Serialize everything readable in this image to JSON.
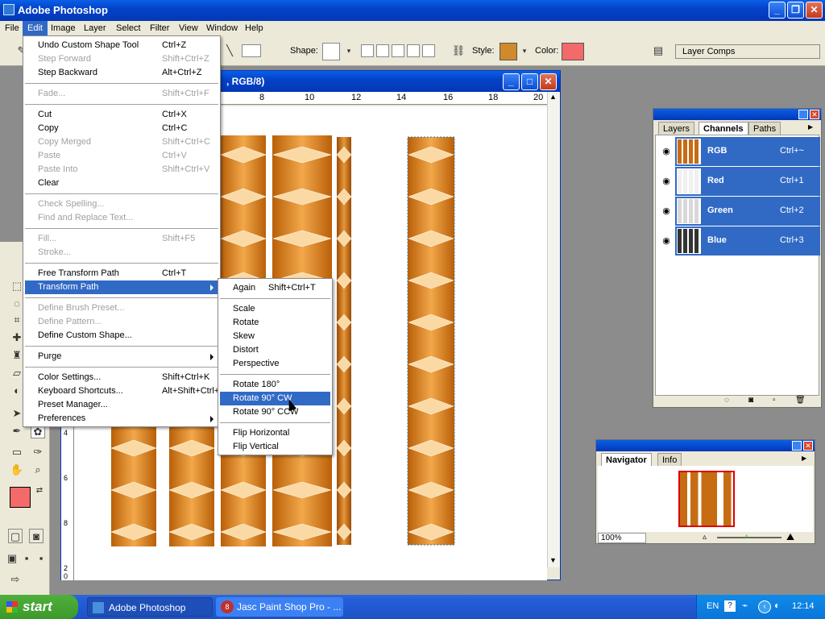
{
  "app": {
    "title": "Adobe Photoshop"
  },
  "menubar": {
    "items": [
      "File",
      "Edit",
      "Image",
      "Layer",
      "Select",
      "Filter",
      "View",
      "Window",
      "Help"
    ],
    "active": "Edit"
  },
  "options": {
    "shape_label": "Shape:",
    "style_label": "Style:",
    "color_label": "Color:",
    "color": "#f26a6a",
    "layer_comps": "Layer Comps"
  },
  "document": {
    "title": ", RGB/8)",
    "ruler_ticks": [
      "8",
      "10",
      "12",
      "14",
      "16",
      "18",
      "20"
    ],
    "left_ruler": [
      "4",
      "6",
      "8",
      "2 0"
    ]
  },
  "edit_menu": {
    "items": [
      {
        "label": "Undo Custom Shape Tool",
        "shortcut": "Ctrl+Z",
        "disabled": false
      },
      {
        "label": "Step Forward",
        "shortcut": "Shift+Ctrl+Z",
        "disabled": true
      },
      {
        "label": "Step Backward",
        "shortcut": "Alt+Ctrl+Z",
        "disabled": false
      },
      {
        "sep": true
      },
      {
        "label": "Fade...",
        "shortcut": "Shift+Ctrl+F",
        "disabled": true
      },
      {
        "sep": true
      },
      {
        "label": "Cut",
        "shortcut": "Ctrl+X",
        "disabled": false
      },
      {
        "label": "Copy",
        "shortcut": "Ctrl+C",
        "disabled": false
      },
      {
        "label": "Copy Merged",
        "shortcut": "Shift+Ctrl+C",
        "disabled": true
      },
      {
        "label": "Paste",
        "shortcut": "Ctrl+V",
        "disabled": true
      },
      {
        "label": "Paste Into",
        "shortcut": "Shift+Ctrl+V",
        "disabled": true
      },
      {
        "label": "Clear",
        "shortcut": "",
        "disabled": false
      },
      {
        "sep": true
      },
      {
        "label": "Check Spelling...",
        "shortcut": "",
        "disabled": true
      },
      {
        "label": "Find and Replace Text...",
        "shortcut": "",
        "disabled": true
      },
      {
        "sep": true
      },
      {
        "label": "Fill...",
        "shortcut": "Shift+F5",
        "disabled": true
      },
      {
        "label": "Stroke...",
        "shortcut": "",
        "disabled": true
      },
      {
        "sep": true
      },
      {
        "label": "Free Transform Path",
        "shortcut": "Ctrl+T",
        "disabled": false
      },
      {
        "label": "Transform Path",
        "shortcut": "",
        "disabled": false,
        "submenu": true,
        "highlighted": true
      },
      {
        "sep": true
      },
      {
        "label": "Define Brush Preset...",
        "shortcut": "",
        "disabled": true
      },
      {
        "label": "Define Pattern...",
        "shortcut": "",
        "disabled": true
      },
      {
        "label": "Define Custom Shape...",
        "shortcut": "",
        "disabled": false
      },
      {
        "sep": true
      },
      {
        "label": "Purge",
        "shortcut": "",
        "disabled": false,
        "submenu": true
      },
      {
        "sep": true
      },
      {
        "label": "Color Settings...",
        "shortcut": "Shift+Ctrl+K",
        "disabled": false
      },
      {
        "label": "Keyboard Shortcuts...",
        "shortcut": "Alt+Shift+Ctrl+K",
        "disabled": false
      },
      {
        "label": "Preset Manager...",
        "shortcut": "",
        "disabled": false
      },
      {
        "label": "Preferences",
        "shortcut": "",
        "disabled": false,
        "submenu": true
      }
    ]
  },
  "transform_submenu": {
    "items": [
      {
        "label": "Again",
        "shortcut": "Shift+Ctrl+T"
      },
      {
        "sep": true
      },
      {
        "label": "Scale",
        "shortcut": ""
      },
      {
        "label": "Rotate",
        "shortcut": ""
      },
      {
        "label": "Skew",
        "shortcut": ""
      },
      {
        "label": "Distort",
        "shortcut": ""
      },
      {
        "label": "Perspective",
        "shortcut": ""
      },
      {
        "sep": true
      },
      {
        "label": "Rotate 180°",
        "shortcut": ""
      },
      {
        "label": "Rotate 90° CW",
        "shortcut": "",
        "highlighted": true
      },
      {
        "label": "Rotate 90° CCW",
        "shortcut": ""
      },
      {
        "sep": true
      },
      {
        "label": "Flip Horizontal",
        "shortcut": ""
      },
      {
        "label": "Flip Vertical",
        "shortcut": ""
      }
    ]
  },
  "layers_panel": {
    "tabs": [
      "Layers",
      "Channels",
      "Paths"
    ],
    "active_tab": "Channels",
    "channels": [
      {
        "name": "RGB",
        "shortcut": "Ctrl+~"
      },
      {
        "name": "Red",
        "shortcut": "Ctrl+1"
      },
      {
        "name": "Green",
        "shortcut": "Ctrl+2"
      },
      {
        "name": "Blue",
        "shortcut": "Ctrl+3"
      }
    ]
  },
  "navigator_panel": {
    "tabs": [
      "Navigator",
      "Info"
    ],
    "active_tab": "Navigator",
    "zoom": "100%"
  },
  "taskbar": {
    "start": "start",
    "items": [
      "Adobe Photoshop",
      "Jasc Paint Shop Pro - ..."
    ],
    "badge": "8",
    "lang": "EN",
    "time": "12:14"
  }
}
